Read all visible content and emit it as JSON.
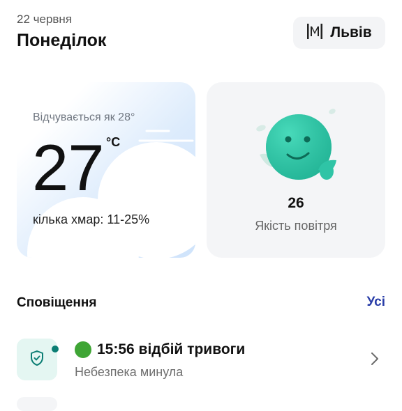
{
  "header": {
    "date": "22 червня",
    "weekday": "Понеділок",
    "city": "Львів",
    "city_icon": "city-logo-icon"
  },
  "weather": {
    "feels_like": "Відчувається як 28°",
    "temperature": "27",
    "unit": "°C",
    "clouds": "кілька хмар: 11-25%"
  },
  "air_quality": {
    "value": "26",
    "label": "Якість повітря",
    "icon": "smiley-face-icon",
    "accent": "#2fc4a6"
  },
  "notifications": {
    "title": "Сповіщення",
    "all_label": "Усі",
    "items": [
      {
        "icon": "shield-check-icon",
        "title": "15:56 відбій тривоги",
        "subtitle": "Небезпека минула",
        "status_color": "#3fa535",
        "unread": true
      }
    ]
  },
  "colors": {
    "link": "#2a3ea8",
    "teal": "#0b7e74"
  }
}
